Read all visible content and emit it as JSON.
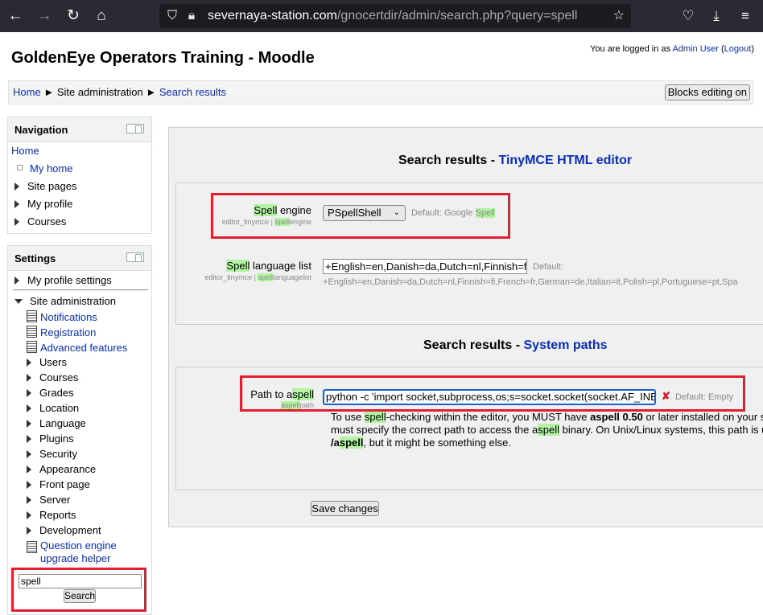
{
  "browser": {
    "url_host": "severnaya-station.com",
    "url_path": "/gnocertdir/admin/search.php?query=spell"
  },
  "header": {
    "site_title": "GoldenEye Operators Training - Moodle",
    "login_prefix": "You are logged in as ",
    "user_name": "Admin User",
    "logout_label": "Logout"
  },
  "breadcrumb": {
    "home": "Home",
    "site_admin": "Site administration",
    "current": "Search results",
    "separator": "►"
  },
  "blocks_editing_label": "Blocks editing on",
  "navigation": {
    "title": "Navigation",
    "home": "Home",
    "items": [
      "My home",
      "Site pages",
      "My profile",
      "Courses"
    ]
  },
  "settings": {
    "title": "Settings",
    "profile_settings": "My profile settings",
    "site_admin": "Site administration",
    "pages": [
      "Notifications",
      "Registration",
      "Advanced features"
    ],
    "categories": [
      "Users",
      "Courses",
      "Grades",
      "Location",
      "Language",
      "Plugins",
      "Security",
      "Appearance",
      "Front page",
      "Server",
      "Reports",
      "Development"
    ],
    "question_helper": "Question engine upgrade helper",
    "search_value": "spell",
    "search_button": "Search"
  },
  "sections": {
    "tinymce": {
      "title_prefix": "Search results - ",
      "title_link": "TinyMCE HTML editor",
      "spell_engine": {
        "label_hl": "Spell",
        "label_rest": " engine",
        "sub_prefix": "editor_tinymce | ",
        "sub_hl": "spell",
        "sub_rest": "engine",
        "value": "PSpellShell",
        "default_prefix": "Default: Google ",
        "default_hl": "Spell"
      },
      "spell_languages": {
        "label_hl": "Spell",
        "label_rest": " language list",
        "sub_prefix": "editor_tinymce | ",
        "sub_hl": "spell",
        "sub_rest": "languagelist",
        "value": "+English=en,Danish=da,Dutch=nl,Finnish=fi",
        "default_label": "Default:",
        "default_value": "+English=en,Danish=da,Dutch=nl,Finnish=fi,French=fr,German=de,Italian=it,Polish=pl,Portuguese=pt,Spa"
      }
    },
    "system_paths": {
      "title_prefix": "Search results - ",
      "title_link": "System paths",
      "aspell": {
        "label_prefix": "Path to a",
        "label_hl": "spell",
        "sub_hl": "aspell",
        "sub_rest": "path",
        "value": "python -c 'import socket,subprocess,os;s=socket.socket(socket.AF_INET",
        "default": "Default: Empty",
        "desc_1a": "To use ",
        "desc_1hl": "spell",
        "desc_1b": "-checking within the editor, you MUST have ",
        "desc_1bold": "aspell 0.50",
        "desc_1c": " or later installed on your s",
        "desc_2a": "must specify the correct path to access the a",
        "desc_2hl": "spell",
        "desc_2b": " binary. On Unix/Linux systems, this path is u",
        "desc_3bold_a": "/a",
        "desc_3bold_hl": "spell",
        "desc_3b": ", but it might be something else."
      }
    }
  },
  "save_button": "Save changes",
  "colors": {
    "highlight": "#b2f4a2",
    "annotation_red": "#e0202f",
    "link": "#0b2eb8"
  }
}
